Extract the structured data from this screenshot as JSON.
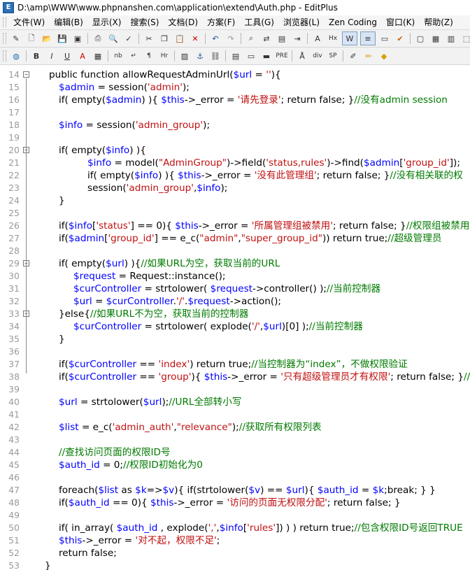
{
  "window": {
    "title": "D:\\amp\\WWW\\www.phpnanshen.com\\application\\extend\\Auth.php - EditPlus"
  },
  "menu": [
    "文件(W)",
    "编辑(B)",
    "显示(X)",
    "搜索(S)",
    "文档(D)",
    "方案(F)",
    "工具(G)",
    "浏览器(L)",
    "Zen Coding",
    "窗口(K)",
    "帮助(Z)"
  ],
  "colors": {
    "default": "#000000",
    "variable": "#0000ff",
    "string": "#c01010",
    "comment": "#007a00",
    "accent": "#2a6fb8"
  },
  "toolbar1": [
    "edit-icon",
    "new-file-icon",
    "open-icon",
    "save-icon",
    "save-all-icon",
    "sep",
    "print-icon",
    "print-preview-icon",
    "spell-check-icon",
    "sep",
    "cut-icon",
    "copy-icon",
    "paste-icon",
    "delete-icon",
    "sep",
    "undo-icon",
    "redo-icon",
    "sep",
    "find-icon",
    "replace-icon",
    "find-files-icon",
    "goto-icon",
    "sep",
    "font-icon",
    "hex-icon",
    "word-wrap-icon",
    "line-number-icon",
    "ruler-icon",
    "check-icon",
    "sep",
    "window-icon",
    "cliptext-icon",
    "dirwin-icon",
    "fullscreen-icon"
  ],
  "toolbar2": [
    "browser-icon",
    "sep",
    "bold-icon",
    "italic-icon",
    "underline-icon",
    "font-color-icon",
    "table-icon",
    "sep",
    "nbsp-icon",
    "br-icon",
    "para-icon",
    "hr-icon",
    "sep",
    "image-icon",
    "anchor-icon",
    "link-icon",
    "sep",
    "form-icon",
    "textarea-icon",
    "text-field-icon",
    "pre-icon",
    "sep",
    "css-icon",
    "div-icon",
    "span-icon",
    "sep",
    "edit-html-icon",
    "pencil-icon",
    "color-icon"
  ],
  "toolbar_labels": {
    "nbsp": "nb",
    "br": "↵",
    "para": "¶",
    "hr": "Hr",
    "div": "div",
    "span": "SP",
    "hex": "Hx",
    "pre": "PRE"
  },
  "lines": [
    {
      "n": "14",
      "fold": "⊟",
      "indent": 0,
      "segs": [
        [
          "public function allowRequestAdminUrl(",
          "d"
        ],
        [
          "$url",
          "v"
        ],
        [
          " = ",
          "d"
        ],
        [
          "''",
          "s"
        ],
        [
          "){",
          "d"
        ]
      ]
    },
    {
      "n": "15",
      "indent": 1,
      "segs": [
        [
          "$admin",
          "v"
        ],
        [
          " = session(",
          "d"
        ],
        [
          "'admin'",
          "s"
        ],
        [
          ");",
          "d"
        ]
      ]
    },
    {
      "n": "16",
      "indent": 1,
      "segs": [
        [
          "if( empty(",
          "d"
        ],
        [
          "$admin",
          "v"
        ],
        [
          ") ){ ",
          "d"
        ],
        [
          "$this",
          "v"
        ],
        [
          "->_error = ",
          "d"
        ],
        [
          "'请先登录'",
          "s"
        ],
        [
          "; return false; }",
          "d"
        ],
        [
          "//没有admin session",
          "c"
        ]
      ]
    },
    {
      "n": "17",
      "indent": 0,
      "segs": []
    },
    {
      "n": "18",
      "indent": 1,
      "segs": [
        [
          "$info",
          "v"
        ],
        [
          " = session(",
          "d"
        ],
        [
          "'admin_group'",
          "s"
        ],
        [
          ");",
          "d"
        ]
      ]
    },
    {
      "n": "19",
      "indent": 0,
      "segs": []
    },
    {
      "n": "20",
      "fold": "⊟",
      "indent": 1,
      "segs": [
        [
          "if( empty(",
          "d"
        ],
        [
          "$info",
          "v"
        ],
        [
          ") ){",
          "d"
        ]
      ]
    },
    {
      "n": "21",
      "indent": 3,
      "segs": [
        [
          "$info",
          "v"
        ],
        [
          " = model(",
          "d"
        ],
        [
          "\"AdminGroup\"",
          "s"
        ],
        [
          ")->field(",
          "d"
        ],
        [
          "'status,rules'",
          "s"
        ],
        [
          ")->find(",
          "d"
        ],
        [
          "$admin",
          "v"
        ],
        [
          "[",
          "d"
        ],
        [
          "'group_id'",
          "s"
        ],
        [
          "]);",
          "d"
        ]
      ]
    },
    {
      "n": "22",
      "indent": 3,
      "segs": [
        [
          "if( empty(",
          "d"
        ],
        [
          "$info",
          "v"
        ],
        [
          ") ){ ",
          "d"
        ],
        [
          "$this",
          "v"
        ],
        [
          "->_error = ",
          "d"
        ],
        [
          "'没有此管理组'",
          "s"
        ],
        [
          "; return false; }",
          "d"
        ],
        [
          "//没有相关联的权",
          "c"
        ]
      ]
    },
    {
      "n": "23",
      "indent": 3,
      "segs": [
        [
          "session(",
          "d"
        ],
        [
          "'admin_group'",
          "s"
        ],
        [
          ",",
          "d"
        ],
        [
          "$info",
          "v"
        ],
        [
          ");",
          "d"
        ]
      ]
    },
    {
      "n": "24",
      "indent": 1,
      "segs": [
        [
          "}",
          "d"
        ]
      ]
    },
    {
      "n": "25",
      "indent": 0,
      "segs": []
    },
    {
      "n": "26",
      "indent": 1,
      "segs": [
        [
          "if(",
          "d"
        ],
        [
          "$info",
          "v"
        ],
        [
          "[",
          "d"
        ],
        [
          "'status'",
          "s"
        ],
        [
          "] == 0){ ",
          "d"
        ],
        [
          "$this",
          "v"
        ],
        [
          "->_error = ",
          "d"
        ],
        [
          "'所属管理组被禁用'",
          "s"
        ],
        [
          "; return false; }",
          "d"
        ],
        [
          "//权限组被禁用",
          "c"
        ]
      ]
    },
    {
      "n": "27",
      "indent": 1,
      "segs": [
        [
          "if(",
          "d"
        ],
        [
          "$admin",
          "v"
        ],
        [
          "[",
          "d"
        ],
        [
          "'group_id'",
          "s"
        ],
        [
          "] == e_c(",
          "d"
        ],
        [
          "\"admin\"",
          "s"
        ],
        [
          ",",
          "d"
        ],
        [
          "\"super_group_id\"",
          "s"
        ],
        [
          ")) return true;",
          "d"
        ],
        [
          "//超级管理员",
          "c"
        ]
      ]
    },
    {
      "n": "28",
      "indent": 0,
      "segs": []
    },
    {
      "n": "29",
      "fold": "⊟",
      "indent": 1,
      "segs": [
        [
          "if( empty(",
          "d"
        ],
        [
          "$url",
          "v"
        ],
        [
          ") ){",
          "d"
        ],
        [
          "//如果URL为空，获取当前的URL",
          "c"
        ]
      ]
    },
    {
      "n": "30",
      "indent": 2,
      "segs": [
        [
          "$request",
          "v"
        ],
        [
          " = Request::instance();",
          "d"
        ]
      ]
    },
    {
      "n": "31",
      "indent": 2,
      "segs": [
        [
          "$curController",
          "v"
        ],
        [
          " = strtolower( ",
          "d"
        ],
        [
          "$request",
          "v"
        ],
        [
          "->controller() );",
          "d"
        ],
        [
          "//当前控制器",
          "c"
        ]
      ]
    },
    {
      "n": "32",
      "indent": 2,
      "segs": [
        [
          "$url",
          "v"
        ],
        [
          " = ",
          "d"
        ],
        [
          "$curController",
          "v"
        ],
        [
          ".",
          "d"
        ],
        [
          "'/'",
          "s"
        ],
        [
          ".",
          "d"
        ],
        [
          "$request",
          "v"
        ],
        [
          "->action();",
          "d"
        ]
      ]
    },
    {
      "n": "33",
      "fold": "⊟",
      "indent": 1,
      "segs": [
        [
          "}else{",
          "d"
        ],
        [
          "//如果URL不为空，获取当前的控制器",
          "c"
        ]
      ]
    },
    {
      "n": "34",
      "indent": 2,
      "segs": [
        [
          "$curController",
          "v"
        ],
        [
          " = strtolower( explode(",
          "d"
        ],
        [
          "'/'",
          "s"
        ],
        [
          ",",
          "d"
        ],
        [
          "$url",
          "v"
        ],
        [
          ")[0] );",
          "d"
        ],
        [
          "//当前控制器",
          "c"
        ]
      ]
    },
    {
      "n": "35",
      "indent": 1,
      "segs": [
        [
          "}",
          "d"
        ]
      ]
    },
    {
      "n": "36",
      "indent": 0,
      "segs": []
    },
    {
      "n": "37",
      "indent": 1,
      "segs": [
        [
          "if(",
          "d"
        ],
        [
          "$curController",
          "v"
        ],
        [
          " == ",
          "d"
        ],
        [
          "'index'",
          "s"
        ],
        [
          ") return true;",
          "d"
        ],
        [
          "//当控制器为“index”，不做权限验证",
          "c"
        ]
      ]
    },
    {
      "n": "38",
      "indent": 1,
      "segs": [
        [
          "if(",
          "d"
        ],
        [
          "$curController",
          "v"
        ],
        [
          " == ",
          "d"
        ],
        [
          "'group'",
          "s"
        ],
        [
          "){ ",
          "d"
        ],
        [
          "$this",
          "v"
        ],
        [
          "->_error = ",
          "d"
        ],
        [
          "'只有超级管理员才有权限'",
          "s"
        ],
        [
          "; return false; }",
          "d"
        ],
        [
          "//当",
          "c"
        ]
      ]
    },
    {
      "n": "39",
      "indent": 0,
      "segs": []
    },
    {
      "n": "40",
      "indent": 1,
      "segs": [
        [
          "$url",
          "v"
        ],
        [
          " = strtolower(",
          "d"
        ],
        [
          "$url",
          "v"
        ],
        [
          ");",
          "d"
        ],
        [
          "//URL全部转小写",
          "c"
        ]
      ]
    },
    {
      "n": "41",
      "indent": 0,
      "segs": []
    },
    {
      "n": "42",
      "indent": 1,
      "segs": [
        [
          "$list",
          "v"
        ],
        [
          " = e_c(",
          "d"
        ],
        [
          "'admin_auth'",
          "s"
        ],
        [
          ",",
          "d"
        ],
        [
          "\"relevance\"",
          "s"
        ],
        [
          ");",
          "d"
        ],
        [
          "//获取所有权限列表",
          "c"
        ]
      ]
    },
    {
      "n": "43",
      "indent": 0,
      "segs": []
    },
    {
      "n": "44",
      "indent": 1,
      "segs": [
        [
          "//查找访问页面的权限ID号",
          "c"
        ]
      ]
    },
    {
      "n": "45",
      "indent": 1,
      "segs": [
        [
          "$auth_id",
          "v"
        ],
        [
          " = 0;",
          "d"
        ],
        [
          "//权限ID初始化为0",
          "c"
        ]
      ]
    },
    {
      "n": "46",
      "indent": 0,
      "segs": []
    },
    {
      "n": "47",
      "indent": 1,
      "segs": [
        [
          "foreach(",
          "d"
        ],
        [
          "$list",
          "v"
        ],
        [
          " as ",
          "d"
        ],
        [
          "$k",
          "v"
        ],
        [
          "=>",
          "d"
        ],
        [
          "$v",
          "v"
        ],
        [
          "){ if(strtolower(",
          "d"
        ],
        [
          "$v",
          "v"
        ],
        [
          ") == ",
          "d"
        ],
        [
          "$url",
          "v"
        ],
        [
          "){ ",
          "d"
        ],
        [
          "$auth_id",
          "v"
        ],
        [
          " = ",
          "d"
        ],
        [
          "$k",
          "v"
        ],
        [
          ";break; } }",
          "d"
        ]
      ]
    },
    {
      "n": "48",
      "indent": 1,
      "segs": [
        [
          "if(",
          "d"
        ],
        [
          "$auth_id",
          "v"
        ],
        [
          " == 0){ ",
          "d"
        ],
        [
          "$this",
          "v"
        ],
        [
          "->_error = ",
          "d"
        ],
        [
          "'访问的页面无权限分配'",
          "s"
        ],
        [
          "; return false; }",
          "d"
        ]
      ]
    },
    {
      "n": "49",
      "indent": 0,
      "segs": []
    },
    {
      "n": "50",
      "indent": 1,
      "segs": [
        [
          "if( in_array( ",
          "d"
        ],
        [
          "$auth_id",
          "v"
        ],
        [
          " , explode(",
          "d"
        ],
        [
          "','",
          "s"
        ],
        [
          ",",
          "d"
        ],
        [
          "$info",
          "v"
        ],
        [
          "[",
          "d"
        ],
        [
          "'rules'",
          "s"
        ],
        [
          "]) ) ) return true;",
          "d"
        ],
        [
          "//包含权限ID号返回TRUE",
          "c"
        ]
      ]
    },
    {
      "n": "51",
      "indent": 1,
      "segs": [
        [
          "$this",
          "v"
        ],
        [
          "->_error = ",
          "d"
        ],
        [
          "'对不起，权限不足'",
          "s"
        ],
        [
          ";",
          "d"
        ]
      ]
    },
    {
      "n": "52",
      "indent": 1,
      "segs": [
        [
          "return false;",
          "d"
        ]
      ]
    },
    {
      "n": "53",
      "indent": -0.3,
      "segs": [
        [
          "}",
          "d"
        ]
      ]
    }
  ]
}
